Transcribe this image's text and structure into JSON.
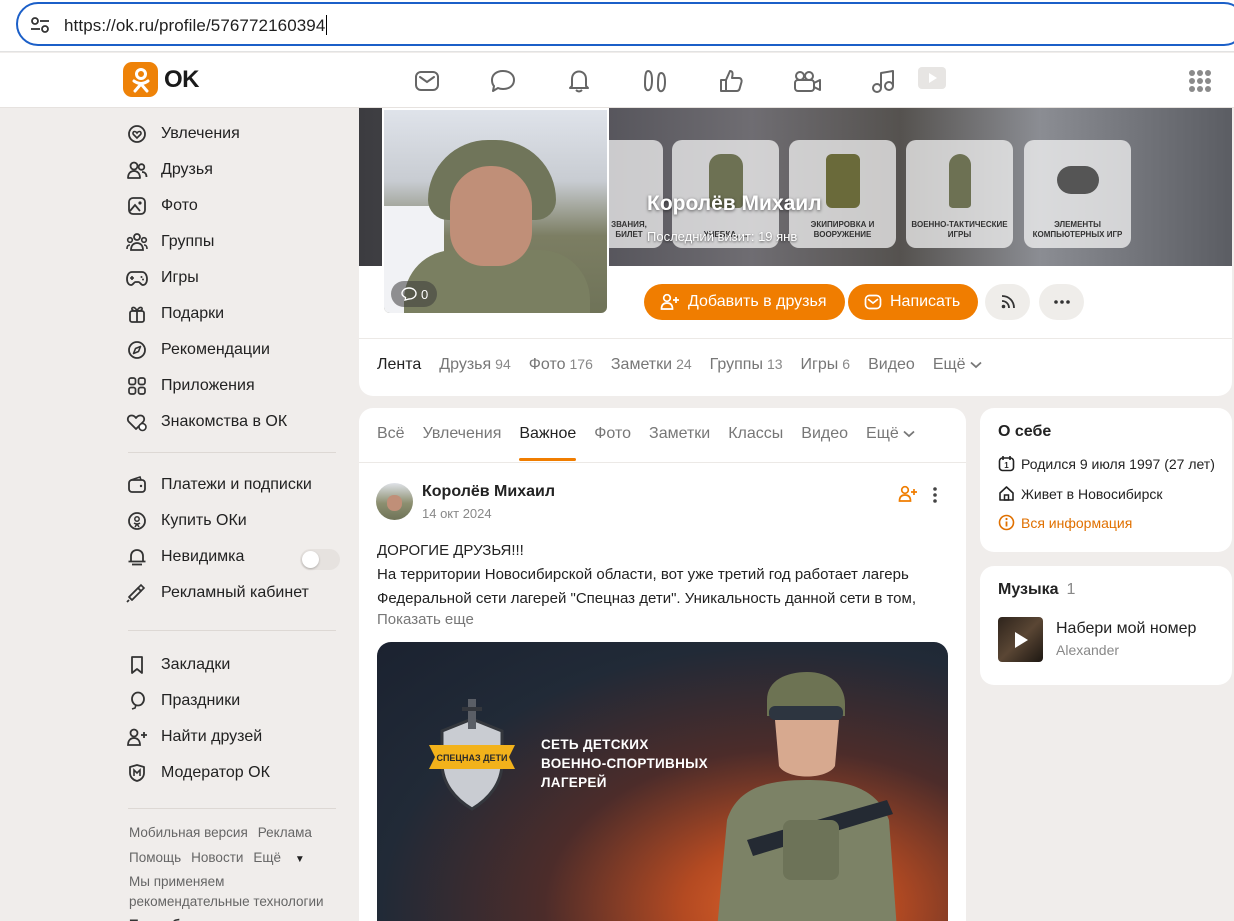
{
  "browser": {
    "url": "https://ok.ru/profile/576772160394"
  },
  "header": {
    "logo_text": "OK",
    "icons": [
      "mail-icon",
      "chat-icon",
      "bell-icon",
      "guests-icon",
      "like-icon",
      "video-camera-icon",
      "music-icon",
      "video-icon",
      "apps-grid-icon"
    ]
  },
  "sidebar": {
    "items": [
      {
        "label": "Увлечения",
        "icon": "hobby-icon"
      },
      {
        "label": "Друзья",
        "icon": "friends-icon"
      },
      {
        "label": "Фото",
        "icon": "photo-icon"
      },
      {
        "label": "Группы",
        "icon": "groups-icon"
      },
      {
        "label": "Игры",
        "icon": "games-icon"
      },
      {
        "label": "Подарки",
        "icon": "gift-icon"
      },
      {
        "label": "Рекомендации",
        "icon": "compass-icon"
      },
      {
        "label": "Приложения",
        "icon": "apps-icon"
      },
      {
        "label": "Знакомства в ОК",
        "icon": "dating-icon"
      }
    ],
    "items2": [
      {
        "label": "Платежи и подписки",
        "icon": "wallet-icon"
      },
      {
        "label": "Купить ОКи",
        "icon": "coin-icon"
      },
      {
        "label": "Невидимка",
        "icon": "invisible-icon"
      },
      {
        "label": "Рекламный кабинет",
        "icon": "ads-icon"
      }
    ],
    "items3": [
      {
        "label": "Закладки",
        "icon": "bookmark-icon"
      },
      {
        "label": "Праздники",
        "icon": "balloon-icon"
      },
      {
        "label": "Найти друзей",
        "icon": "add-friend-icon"
      },
      {
        "label": "Модератор ОК",
        "icon": "moderator-icon"
      }
    ],
    "footer": {
      "mobile": "Мобильная версия",
      "ads": "Реклама",
      "help": "Помощь",
      "news": "Новости",
      "more": "Ещё",
      "note": "Мы применяем рекомендательные технологии",
      "details": "Подробнее"
    }
  },
  "profile": {
    "name": "Королёв Михаил",
    "last_visit": "Последний визит: 19 янв",
    "comment_count": "0",
    "add_friend": "Добавить в друзья",
    "write": "Написать",
    "cover_captions": [
      "ЗВАНИЯ, БИЛЕТ",
      "УЧЕБКА, ...",
      "ЭКИПИРОВКА И ВООРУЖЕНИЕ",
      "ВОЕННО-ТАКТИЧЕСКИЕ ИГРЫ",
      "ЭЛЕМЕНТЫ КОМПЬЮТЕРНЫХ ИГР"
    ],
    "tabs": [
      {
        "label": "Лента",
        "count": ""
      },
      {
        "label": "Друзья",
        "count": "94"
      },
      {
        "label": "Фото",
        "count": "176"
      },
      {
        "label": "Заметки",
        "count": "24"
      },
      {
        "label": "Группы",
        "count": "13"
      },
      {
        "label": "Игры",
        "count": "6"
      },
      {
        "label": "Видео",
        "count": ""
      },
      {
        "label": "Ещё",
        "count": ""
      }
    ]
  },
  "feed": {
    "tabs": [
      "Всё",
      "Увлечения",
      "Важное",
      "Фото",
      "Заметки",
      "Классы",
      "Видео",
      "Ещё"
    ],
    "active_tab": "Важное",
    "post": {
      "author": "Королёв Михаил",
      "date": "14 окт 2024",
      "line1": "ДОРОГИЕ ДРУЗЬЯ!!!",
      "line2": "На территории Новосибирской области, вот уже третий год работает лагерь",
      "line3": "Федеральной сети лагерей \"Спецназ дети\". Уникальность данной сети в том,",
      "show_more": "Показать еще",
      "image_badge": "СПЕЦНАЗ ДЕТИ",
      "image_line1": "СЕТЬ ДЕТСКИХ",
      "image_line2": "ВОЕННО-СПОРТИВНЫХ",
      "image_line3": "ЛАГЕРЕЙ"
    }
  },
  "about": {
    "title": "О себе",
    "born": "Родился 9 июля 1997 (27 лет)",
    "lives": "Живет в Новосибирск",
    "all_info": "Вся информация"
  },
  "music": {
    "title": "Музыка",
    "count": "1",
    "track_title": "Набери мой номер",
    "track_artist": "Alexander"
  },
  "colors": {
    "accent": "#f07d00",
    "browser_focus": "#1b5fc8"
  }
}
